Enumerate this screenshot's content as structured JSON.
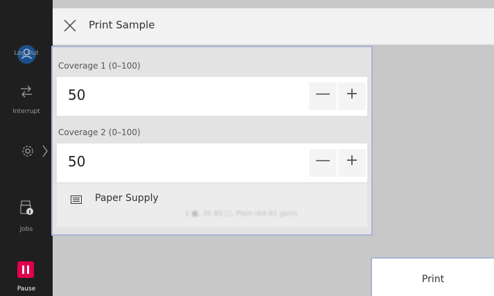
{
  "rail": {
    "logout_label": "Log Out",
    "interrupt_label": "Interrupt",
    "jobs_label": "Jobs",
    "pause_label": "Pause"
  },
  "header": {
    "title": "Print Sample"
  },
  "coverage1": {
    "label": "Coverage 1 (0–100)",
    "value": "50",
    "minus": "—",
    "plus": "+"
  },
  "coverage2": {
    "label": "Coverage 2 (0–100)",
    "value": "50",
    "minus": "—",
    "plus": "+"
  },
  "paper": {
    "label": "Paper Supply",
    "value": "1 ■, 35 B5 ▢, Plain (64-81 gsm)"
  },
  "print_button": {
    "label": "Print"
  },
  "colors": {
    "pause": "#e0004d",
    "logout": "#1d4f8a",
    "focus_border": "#a9b4d3"
  }
}
